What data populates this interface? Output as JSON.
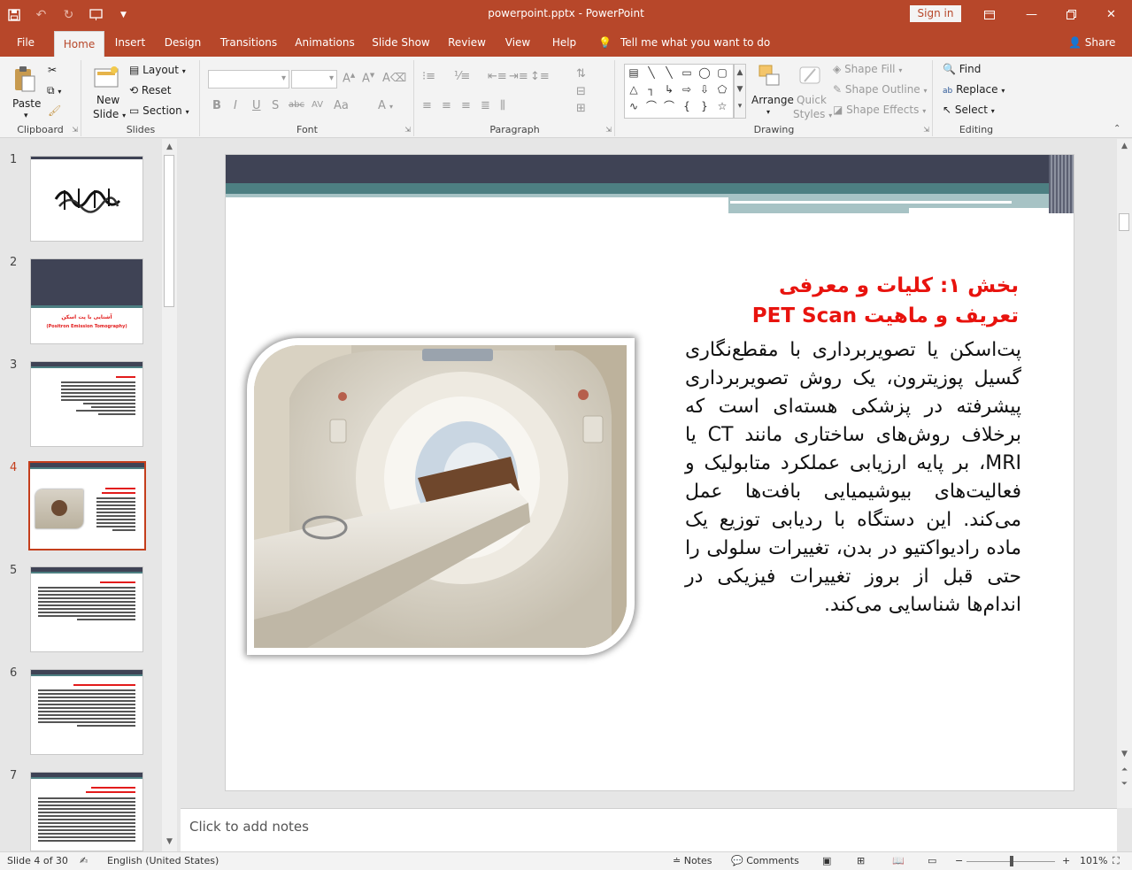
{
  "window": {
    "title": "powerpoint.pptx  -  PowerPoint",
    "signin": "Sign in"
  },
  "tabs": [
    "File",
    "Home",
    "Insert",
    "Design",
    "Transitions",
    "Animations",
    "Slide Show",
    "Review",
    "View",
    "Help"
  ],
  "active_tab": "Home",
  "tell_me": "Tell me what you want to do",
  "share": "Share",
  "ribbon": {
    "clipboard": {
      "label": "Clipboard",
      "paste": "Paste"
    },
    "slides": {
      "label": "Slides",
      "new_slide_1": "New",
      "new_slide_2": "Slide",
      "layout": "Layout",
      "reset": "Reset",
      "section": "Section"
    },
    "font": {
      "label": "Font"
    },
    "paragraph": {
      "label": "Paragraph"
    },
    "drawing": {
      "label": "Drawing",
      "arrange": "Arrange",
      "quick_styles_1": "Quick",
      "quick_styles_2": "Styles",
      "shape_fill": "Shape Fill",
      "shape_outline": "Shape Outline",
      "shape_effects": "Shape Effects"
    },
    "editing": {
      "label": "Editing",
      "find": "Find",
      "replace": "Replace",
      "select": "Select"
    }
  },
  "thumbnails": {
    "numbers": [
      "1",
      "2",
      "3",
      "4",
      "5",
      "6",
      "7"
    ],
    "active": "4",
    "slide2_title": "آشنایی با پت اسکن",
    "slide2_sub": "(Positron Emission Tomography)"
  },
  "slide": {
    "title_line1": "بخش ۱: کلیات و معرفی",
    "title_line2": "تعریف و ماهیت PET Scan",
    "body": "پت‌اسکن یا تصویربرداری با مقطع‌نگاری گسیل پوزیترون، یک روش تصویربرداری پیشرفته در پزشکی هسته‌ای است که برخلاف روش‌های ساختاری مانند CT یا MRI، بر پایه ارزیابی عملکرد متابولیک و فعالیت‌های بیوشیمیایی بافت‌ها عمل می‌کند. این دستگاه با ردیابی توزیع یک ماده رادیواکتیو در بدن، تغییرات سلولی را حتی قبل از بروز تغییرات فیزیکی در اندام‌ها شناسایی می‌کند."
  },
  "notes_placeholder": "Click to add notes",
  "status": {
    "slide_count": "Slide 4 of 30",
    "language": "English (United States)",
    "notes": "Notes",
    "comments": "Comments",
    "zoom": "101%"
  }
}
